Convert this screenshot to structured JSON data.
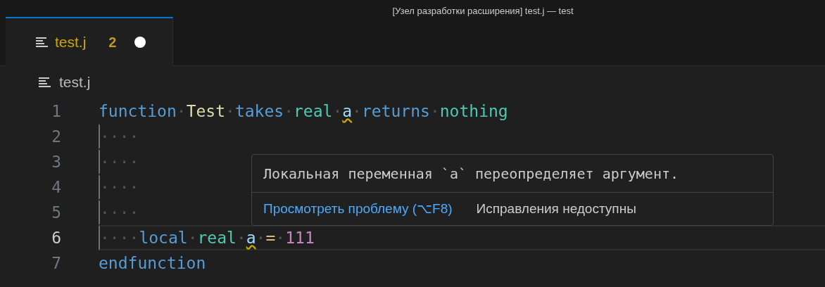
{
  "window": {
    "title": "[Узел разработки расширения] test.j — test"
  },
  "tabs": [
    {
      "label": "test.j",
      "problems": "2",
      "modified": true,
      "selected": true
    }
  ],
  "breadcrumb": {
    "label": "test.j"
  },
  "editor": {
    "lines": [
      {
        "number": "1",
        "current": false,
        "tokens": [
          {
            "text": "function",
            "kind": "keyword"
          },
          {
            "text": "·",
            "kind": "ws"
          },
          {
            "text": "Test",
            "kind": "name"
          },
          {
            "text": "·",
            "kind": "ws"
          },
          {
            "text": "takes",
            "kind": "keyword"
          },
          {
            "text": "·",
            "kind": "ws"
          },
          {
            "text": "real",
            "kind": "type"
          },
          {
            "text": "·",
            "kind": "ws"
          },
          {
            "text": "a",
            "kind": "variable",
            "squiggle": true
          },
          {
            "text": "·",
            "kind": "ws"
          },
          {
            "text": "returns",
            "kind": "keyword"
          },
          {
            "text": "·",
            "kind": "ws"
          },
          {
            "text": "nothing",
            "kind": "type"
          }
        ]
      },
      {
        "number": "2",
        "current": false,
        "tokens": [
          {
            "text": "····",
            "kind": "ws"
          }
        ]
      },
      {
        "number": "3",
        "current": false,
        "tokens": [
          {
            "text": "····",
            "kind": "ws"
          }
        ]
      },
      {
        "number": "4",
        "current": false,
        "tokens": [
          {
            "text": "····",
            "kind": "ws"
          }
        ]
      },
      {
        "number": "5",
        "current": false,
        "tokens": [
          {
            "text": "····",
            "kind": "ws"
          }
        ]
      },
      {
        "number": "6",
        "current": true,
        "tokens": [
          {
            "text": "····",
            "kind": "ws"
          },
          {
            "text": "local",
            "kind": "keyword"
          },
          {
            "text": "·",
            "kind": "ws"
          },
          {
            "text": "real",
            "kind": "type"
          },
          {
            "text": "·",
            "kind": "ws"
          },
          {
            "text": "a",
            "kind": "variable",
            "squiggle": true
          },
          {
            "text": "·",
            "kind": "ws"
          },
          {
            "text": "=",
            "kind": "operator"
          },
          {
            "text": "·",
            "kind": "ws"
          },
          {
            "text": "111",
            "kind": "number"
          }
        ]
      },
      {
        "number": "7",
        "current": false,
        "tokens": [
          {
            "text": "endfunction",
            "kind": "keyword"
          }
        ]
      }
    ]
  },
  "hover": {
    "message": "Локальная переменная `a` переопределяет аргумент.",
    "view_problem": "Просмотреть проблему (⌥F8)",
    "no_fixes": "Исправления недоступны"
  }
}
